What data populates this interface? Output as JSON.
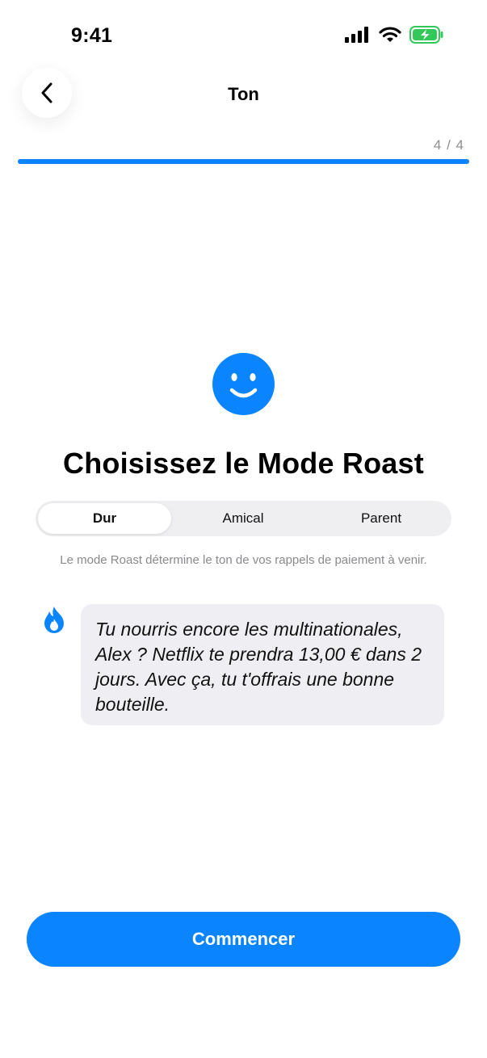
{
  "status_bar": {
    "time": "9:41"
  },
  "nav": {
    "title": "Ton"
  },
  "progress": {
    "label": "4 / 4",
    "fraction": 1.0
  },
  "headline": "Choisissez le Mode Roast",
  "segmented": {
    "options": [
      "Dur",
      "Amical",
      "Parent"
    ],
    "selected": "Dur"
  },
  "helper_text": "Le mode Roast détermine le ton de vos rappels de paiement à venir.",
  "preview_message": "Tu nourris encore les multinationales, Alex ? Netflix te prendra 13,00 € dans 2 jours. Avec ça, tu t'offrais une bonne bouteille.",
  "cta": {
    "label": "Commencer"
  },
  "colors": {
    "accent": "#0a84ff",
    "battery": "#34c759"
  },
  "icons": [
    "back-chevron-icon",
    "cellular-signal-icon",
    "wifi-icon",
    "battery-charging-icon",
    "smiley-icon",
    "flame-icon"
  ]
}
